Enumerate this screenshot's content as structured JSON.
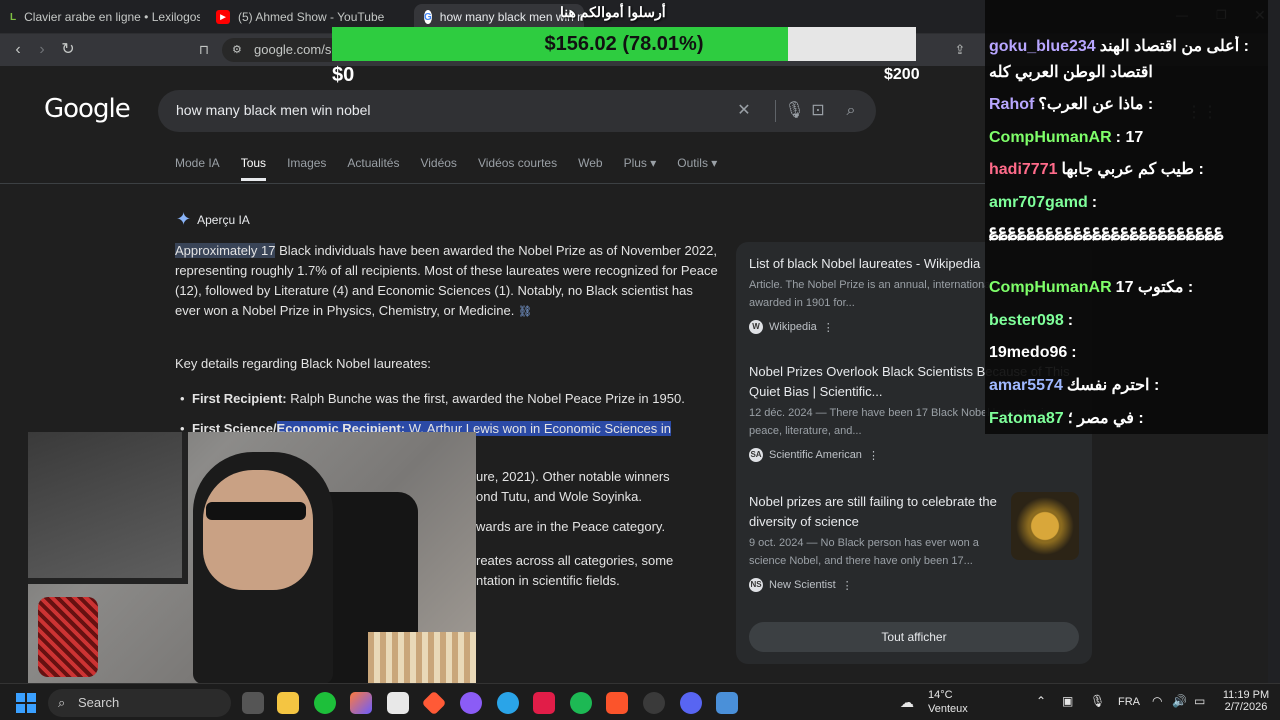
{
  "browser": {
    "tabs": [
      {
        "label": "Clavier arabe en ligne • Lexilogos",
        "icon": "lexilogos-icon"
      },
      {
        "label": "(5) Ahmed Show - YouTube",
        "icon": "youtube-icon"
      },
      {
        "label": "how many black men win nobe",
        "icon": "google-icon"
      }
    ],
    "address": "google.com/se"
  },
  "donation": {
    "title": "أرسلوا أموالكم هنا",
    "amount_label": "$156.02 (78.01%)",
    "progress_fraction": 0.7801,
    "min_label": "$0",
    "max_label": "$200",
    "fill_color": "#2ecc40"
  },
  "google": {
    "logo_text": "Google",
    "query": "how many black men win nobel",
    "tabs": [
      "Mode IA",
      "Tous",
      "Images",
      "Actualités",
      "Vidéos",
      "Vidéos courtes",
      "Web",
      "Plus ▾",
      "Outils ▾"
    ],
    "active_tab": "Tous"
  },
  "ai_overview": {
    "header": "Aperçu IA",
    "highlight": "Approximately 17",
    "paragraph": " Black individuals have been awarded the Nobel Prize as of November 2022, representing roughly 1.7% of all recipients. Most of these laureates were recognized for Peace (12), followed by Literature (4) and Economic Sciences (1). Notably, no Black scientist has ever won a Nobel Prize in Physics, Chemistry, or Medicine.",
    "key_details": "Key details regarding Black Nobel laureates:",
    "bullet1_bold": "First Recipient:",
    "bullet1_text": " Ralph Bunche was the first, awarded the Nobel Peace Prize in 1950.",
    "bullet2_bold_a": "First Science/",
    "bullet2_bold_b": "Economic Recipient:",
    "bullet2_text": " W. Arthur Lewis won in Economic Sciences in",
    "frag1": "ure, 2021). Other notable winners",
    "frag2": "ond Tutu, and Wole Soyinka.",
    "frag3": "wards are in the Peace category.",
    "frag4": "reates across all categories, some",
    "frag5": "ntation in scientific fields."
  },
  "sources": [
    {
      "title": "List of black Nobel laureates - Wikipedia",
      "snippet": "Article. The Nobel Prize is an annual, international prize first awarded in 1901 for...",
      "site": "Wikipedia",
      "site_letter": "W"
    },
    {
      "title": "Nobel Prizes Overlook Black Scientists Because of This Quiet Bias | Scientific...",
      "snippet": "12 déc. 2024 — There have been 17 Black Nobel laureates in peace, literature, and...",
      "site": "Scientific American",
      "site_letter": "SA"
    },
    {
      "title": "Nobel prizes are still failing to celebrate the diversity of science",
      "snippet": "9 oct. 2024 — No Black person has ever won a science Nobel, and there have only been 17...",
      "site": "New Scientist",
      "site_letter": "NS"
    }
  ],
  "show_all_label": "Tout afficher",
  "chat": [
    {
      "name": "goku_blue234",
      "color": "#b8a6ff",
      "msg": "أعلى من اقتصاد الهند :"
    },
    {
      "name": "",
      "color": "#ffffff",
      "msg": "اقتصاد الوطن العربي كله"
    },
    {
      "name": "Rahof",
      "color": "#b8a6ff",
      "msg": "ماذا عن العرب؟ :"
    },
    {
      "name": "CompHumanAR",
      "color": "#7fff6a",
      "msg": ": 17"
    },
    {
      "name": "hadi7771",
      "color": "#ff6b8a",
      "msg": "طيب كم عربي جابها :"
    },
    {
      "name": "amr707gamd",
      "color": "#7fff9a",
      "msg": ":"
    },
    {
      "name": "",
      "color": "#ffffff",
      "msg": "؏؏؏؏؏؏؏؏؏؏؏؏؏؏؏؏؏؏؏؏؏؏؏؏؏"
    },
    {
      "name": "CompHumanAR",
      "color": "#7fff6a",
      "msg": "مكتوب 17 :"
    },
    {
      "name": "bester098",
      "color": "#7fff9a",
      "msg": ":"
    },
    {
      "name": "19medo96",
      "color": "#ffffff",
      "msg": ":"
    },
    {
      "name": "amar5574",
      "color": "#9fb8ff",
      "msg": "احترم نفسك :"
    },
    {
      "name": "Fatoma87",
      "color": "#7fff9a",
      "msg": "في مصر ؛ :"
    }
  ],
  "taskbar": {
    "search_label": "Search",
    "weather_temp": "14°C",
    "weather_desc": "Venteux",
    "lang": "FRA",
    "time": "11:19 PM",
    "date": "2/7/2026"
  }
}
